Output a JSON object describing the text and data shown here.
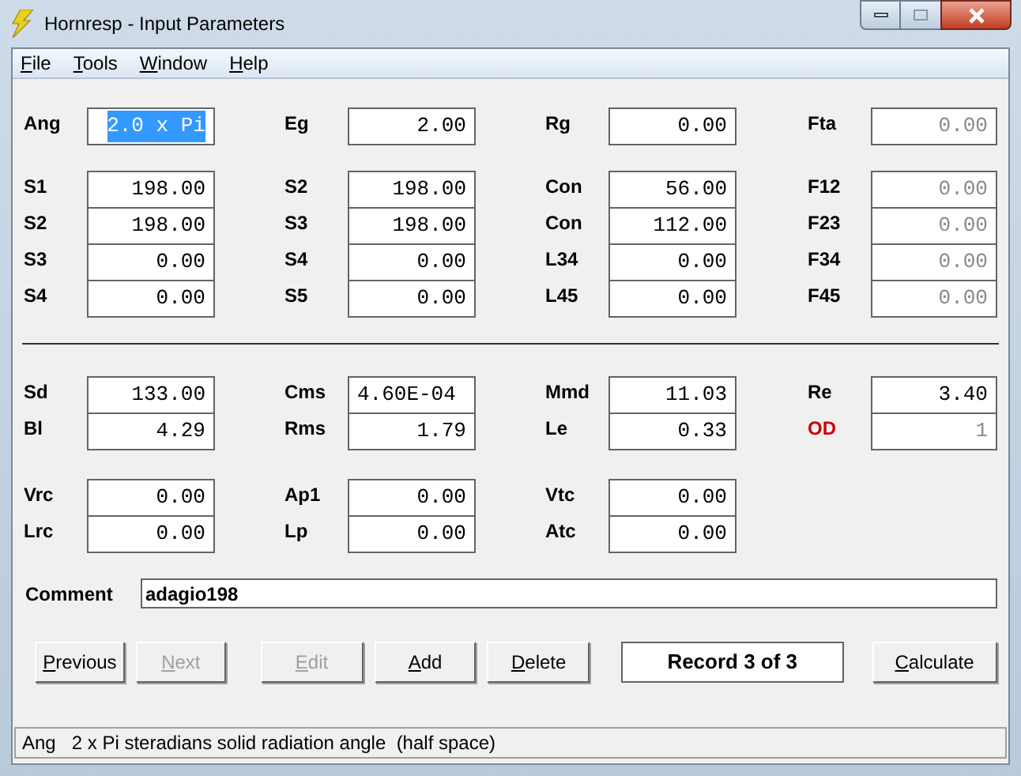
{
  "window": {
    "title": "Hornresp - Input Parameters"
  },
  "menu": [
    "File",
    "Tools",
    "Window",
    "Help"
  ],
  "groups": [
    {
      "rows": [
        [
          {
            "label": "Ang",
            "value": "2.0 x Pi",
            "selected": true,
            "disabled": false
          },
          {
            "label": "Eg",
            "value": "2.00",
            "selected": false,
            "disabled": false
          },
          {
            "label": "Rg",
            "value": "0.00",
            "selected": false,
            "disabled": false
          },
          {
            "label": "Fta",
            "value": "0.00",
            "selected": false,
            "disabled": true
          }
        ]
      ]
    },
    {
      "rows": [
        [
          {
            "label": "S1",
            "value": "198.00",
            "selected": false,
            "disabled": false
          },
          {
            "label": "S2",
            "value": "198.00",
            "selected": false,
            "disabled": false
          },
          {
            "label": "Con",
            "value": "56.00",
            "selected": false,
            "disabled": false
          },
          {
            "label": "F12",
            "value": "0.00",
            "selected": false,
            "disabled": true
          }
        ],
        [
          {
            "label": "S2",
            "value": "198.00",
            "selected": false,
            "disabled": false
          },
          {
            "label": "S3",
            "value": "198.00",
            "selected": false,
            "disabled": false
          },
          {
            "label": "Con",
            "value": "112.00",
            "selected": false,
            "disabled": false
          },
          {
            "label": "F23",
            "value": "0.00",
            "selected": false,
            "disabled": true
          }
        ],
        [
          {
            "label": "S3",
            "value": "0.00",
            "selected": false,
            "disabled": false
          },
          {
            "label": "S4",
            "value": "0.00",
            "selected": false,
            "disabled": false
          },
          {
            "label": "L34",
            "value": "0.00",
            "selected": false,
            "disabled": false
          },
          {
            "label": "F34",
            "value": "0.00",
            "selected": false,
            "disabled": true
          }
        ],
        [
          {
            "label": "S4",
            "value": "0.00",
            "selected": false,
            "disabled": false
          },
          {
            "label": "S5",
            "value": "0.00",
            "selected": false,
            "disabled": false
          },
          {
            "label": "L45",
            "value": "0.00",
            "selected": false,
            "disabled": false
          },
          {
            "label": "F45",
            "value": "0.00",
            "selected": false,
            "disabled": true
          }
        ]
      ]
    },
    {
      "separator_before": true,
      "rows": [
        [
          {
            "label": "Sd",
            "value": "133.00",
            "selected": false,
            "disabled": false
          },
          {
            "label": "Cms",
            "value": "4.60E-04",
            "selected": false,
            "disabled": false,
            "left_aligned": true
          },
          {
            "label": "Mmd",
            "value": "11.03",
            "selected": false,
            "disabled": false
          },
          {
            "label": "Re",
            "value": "3.40",
            "selected": false,
            "disabled": false
          }
        ],
        [
          {
            "label": "Bl",
            "value": "4.29",
            "selected": false,
            "disabled": false
          },
          {
            "label": "Rms",
            "value": "1.79",
            "selected": false,
            "disabled": false
          },
          {
            "label": "Le",
            "value": "0.33",
            "selected": false,
            "disabled": false
          },
          {
            "label": "OD",
            "value": "1",
            "selected": false,
            "disabled": true,
            "warning": true
          }
        ]
      ]
    },
    {
      "rows": [
        [
          {
            "label": "Vrc",
            "value": "0.00",
            "selected": false,
            "disabled": false
          },
          {
            "label": "Ap1",
            "value": "0.00",
            "selected": false,
            "disabled": false
          },
          {
            "label": "Vtc",
            "value": "0.00",
            "selected": false,
            "disabled": false
          }
        ],
        [
          {
            "label": "Lrc",
            "value": "0.00",
            "selected": false,
            "disabled": false
          },
          {
            "label": "Lp",
            "value": "0.00",
            "selected": false,
            "disabled": false
          },
          {
            "label": "Atc",
            "value": "0.00",
            "selected": false,
            "disabled": false
          }
        ]
      ]
    }
  ],
  "comment": {
    "label": "Comment",
    "value": "adagio198"
  },
  "buttons": [
    {
      "kind": "button",
      "label": "Previous",
      "disabled": false
    },
    {
      "kind": "button",
      "label": "Next",
      "disabled": true
    },
    {
      "kind": "button",
      "label": "Edit",
      "disabled": true
    },
    {
      "kind": "button",
      "label": "Add",
      "disabled": false
    },
    {
      "kind": "button",
      "label": "Delete",
      "disabled": false
    },
    {
      "kind": "record",
      "label": "Record 3 of 3"
    },
    {
      "kind": "button",
      "label": "Calculate",
      "disabled": false
    }
  ],
  "status_bar": {
    "key": "Ang",
    "text": "2 x Pi steradians solid radiation angle  (half space)"
  }
}
